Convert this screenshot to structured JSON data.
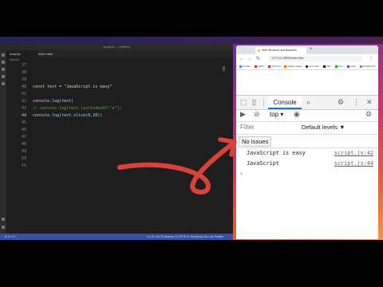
{
  "vscode": {
    "title": "script.js — Untitled",
    "tabs": [
      "script.js",
      "index.html"
    ],
    "breadcrumb": "script.js",
    "lines": [
      {
        "num": "37",
        "code": ""
      },
      {
        "num": "38",
        "code": ""
      },
      {
        "num": "39",
        "code": ""
      },
      {
        "num": "40",
        "code": "const text = \"JavaScript is easy\""
      },
      {
        "num": "41",
        "code": ""
      },
      {
        "num": "42",
        "code": "console.log(text)"
      },
      {
        "num": "43",
        "code": "// console.log(text.lastIndexOf(\"a\"))"
      },
      {
        "num": "44",
        "code": "console.log(text.slice(0,10))"
      },
      {
        "num": "45",
        "code": ""
      },
      {
        "num": "46",
        "code": ""
      },
      {
        "num": "47",
        "code": ""
      },
      {
        "num": "48",
        "code": ""
      },
      {
        "num": "49",
        "code": ""
      },
      {
        "num": "50",
        "code": ""
      },
      {
        "num": "51",
        "code": ""
      }
    ],
    "status_left": "⊗ 0 ⚠ 0",
    "status_right": "Ln 44, Col 29   Spaces: 2   UTF-8   LF   JavaScript   Go Live   Prettier"
  },
  "chrome": {
    "tab_title": "Web Structure and Beautiful",
    "url": "127.0.0.1:5500/index.html",
    "bookmarks": [
      "Google",
      "Netflix",
      "YouTube",
      "Hacker News",
      "Hot Code",
      "DEV",
      "Free",
      "Code",
      "Reading list"
    ]
  },
  "devtools": {
    "console_tab": "Console",
    "more": "»",
    "context": "top",
    "filter_placeholder": "Filter",
    "levels": "Default levels ▼",
    "issues": "No Issues",
    "logs": [
      {
        "message": "JavaScript is easy",
        "source": "script.js:42"
      },
      {
        "message": "JavaScript",
        "source": "script.js:44"
      }
    ],
    "prompt": "›"
  },
  "colors": {
    "arrow": "#d8423a",
    "accent": "#1a73e8"
  }
}
